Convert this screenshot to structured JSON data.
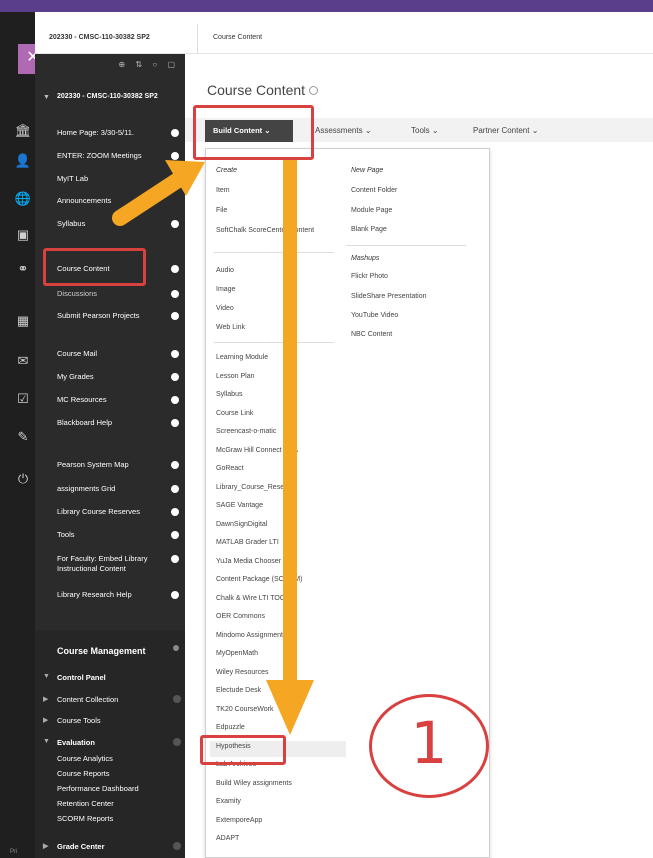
{
  "breadcrumb": {
    "course": "202330 - CMSC-110-30382 SP2",
    "page": "Course Content"
  },
  "course_menu": {
    "title": "202330 - CMSC-110-30382 SP2",
    "items": [
      {
        "label": "Home Page: 3/30-5/11."
      },
      {
        "label": "ENTER: ZOOM Meetings"
      },
      {
        "label": "MyIT Lab"
      },
      {
        "label": "Announcements"
      },
      {
        "label": "Syllabus"
      },
      {
        "label": "Course Content"
      },
      {
        "label": "Discussions"
      },
      {
        "label": "Submit Pearson Projects"
      },
      {
        "label": "Course Mail"
      },
      {
        "label": "My Grades"
      },
      {
        "label": "MC Resources"
      },
      {
        "label": "Blackboard Help"
      },
      {
        "label": "Pearson System Map"
      },
      {
        "label": "assignments Grid"
      },
      {
        "label": "Library Course Reserves"
      },
      {
        "label": "Tools"
      },
      {
        "label": "For Faculty: Embed Library Instructional Content"
      },
      {
        "label": "Library Research Help"
      }
    ]
  },
  "course_management": {
    "heading": "Course Management",
    "items": [
      {
        "label": "Control Panel"
      },
      {
        "label": "Content Collection"
      },
      {
        "label": "Course Tools"
      },
      {
        "label": "Evaluation"
      },
      {
        "label": "Course Analytics"
      },
      {
        "label": "Course Reports"
      },
      {
        "label": "Performance Dashboard"
      },
      {
        "label": "Retention Center"
      },
      {
        "label": "SCORM Reports"
      },
      {
        "label": "Grade Center"
      }
    ]
  },
  "main": {
    "page_title": "Course Content",
    "action_bar": {
      "build_content": "Build Content",
      "assessments": "Assessments",
      "tools": "Tools",
      "partner_content": "Partner Content"
    }
  },
  "dropdown": {
    "col1": {
      "header_create": "Create",
      "group1": [
        "Item",
        "File",
        "SoftChalk ScoreCenter Content"
      ],
      "group2": [
        "Audio",
        "Image",
        "Video",
        "Web Link"
      ],
      "group3": [
        "Learning Module",
        "Lesson Plan",
        "Syllabus",
        "Course Link",
        "Screencast-o-matic",
        "McGraw Hill Connect LTIA",
        "GoReact",
        "Library_Course_Reserves",
        "SAGE Vantage",
        "DawnSignDigital",
        "MATLAB Grader LTI",
        "YuJa Media Chooser CM",
        "Content Package (SCORM)",
        "Chalk & Wire LTI TOC",
        "OER Commons",
        "Mindomo Assignments",
        "MyOpenMath",
        "Wiley Resources",
        "Electude Desk",
        "TK20 CourseWork",
        "Edpuzzle",
        "Hypothesis",
        "Lab Archives",
        "Build Wiley assignments",
        "Examity",
        "ExtemporeApp",
        "ADAPT"
      ]
    },
    "col2": {
      "header_new_page": "New Page",
      "new_page": [
        "Content Folder",
        "Module Page",
        "Blank Page"
      ],
      "header_mashups": "Mashups",
      "mashups": [
        "Flickr Photo",
        "SlideShare Presentation",
        "YouTube Video",
        "NBC Content"
      ]
    }
  },
  "annotation": {
    "step_number": "1"
  },
  "colors": {
    "rail": "#1f1f1f",
    "menu": "#2b2b2b",
    "accent_purple": "#b06ab3",
    "highlight_red": "#d94040",
    "arrow_orange": "#f5a623"
  }
}
